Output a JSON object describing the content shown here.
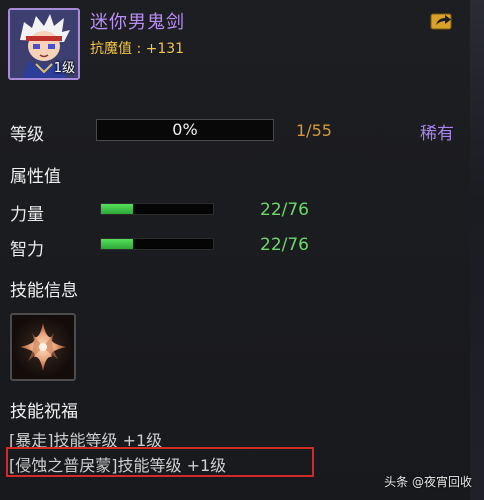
{
  "item": {
    "name": "迷你男鬼剑",
    "resist_label": "抗魔值 : +131",
    "avatar_level": "1级",
    "avatar_icon": "ghost-swordsman-portrait-icon"
  },
  "level": {
    "label": "等级",
    "percent_text": "0%",
    "progress": 0,
    "count": "1/55",
    "rarity": "稀有"
  },
  "attributes": {
    "title": "属性值",
    "stats": [
      {
        "label": "力量",
        "value": "22/76",
        "fill": 0.29
      },
      {
        "label": "智力",
        "value": "22/76",
        "fill": 0.29
      }
    ]
  },
  "skill_info": {
    "title": "技能信息",
    "icon": "four-point-star-skill-icon"
  },
  "blessing": {
    "title": "技能祝福",
    "lines": [
      "[暴走]技能等级 +1级",
      "[侵蚀之普戾蒙]技能等级 +1级"
    ]
  },
  "watermark": "头条 @夜宵回收",
  "colors": {
    "title_purple": "#b98ef5",
    "resist_gold": "#f3c24a",
    "count_orange": "#d59a37",
    "rarity_purple": "#a884f0",
    "stat_green": "#6dd86a",
    "highlight_red": "#d22a2a"
  }
}
